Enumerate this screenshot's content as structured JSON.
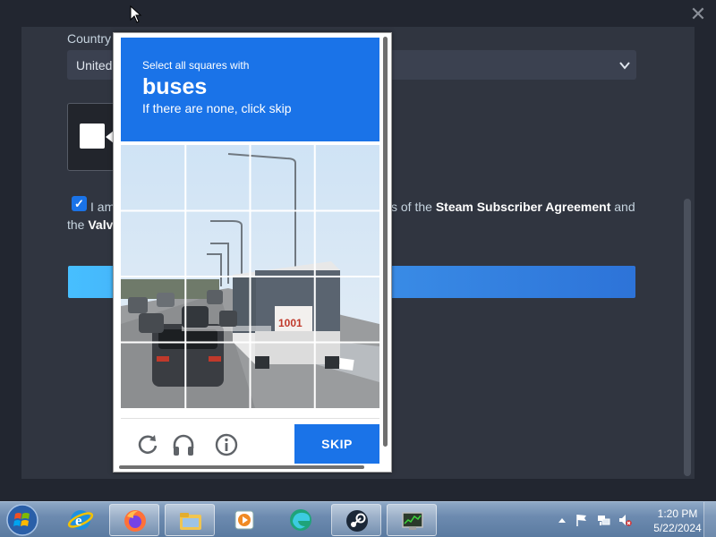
{
  "steam": {
    "country_label": "Country",
    "country_value": "United",
    "agree_prefix": "I am",
    "agree_mid": "s of the",
    "subscriber_agreement": "Steam Subscriber Agreement",
    "and_word": "and",
    "the_word": "the",
    "valve_partial": "Valv",
    "close_icon": "close-icon"
  },
  "captcha": {
    "instruction": "Select all squares with",
    "target": "buses",
    "subtext": "If there are none, click skip",
    "skip_label": "SKIP",
    "icons": [
      "reload-icon",
      "headphones-icon",
      "info-icon"
    ],
    "grid_size": 4
  },
  "taskbar": {
    "apps": [
      "internet-explorer",
      "firefox",
      "file-explorer",
      "media-player",
      "edge",
      "steam",
      "task-manager"
    ],
    "clock_time": "1:20 PM",
    "clock_date": "5/22/2024"
  },
  "colors": {
    "accent_blue": "#1a73e8",
    "steam_bg": "#303540",
    "taskbar": "#6d8bb0"
  }
}
